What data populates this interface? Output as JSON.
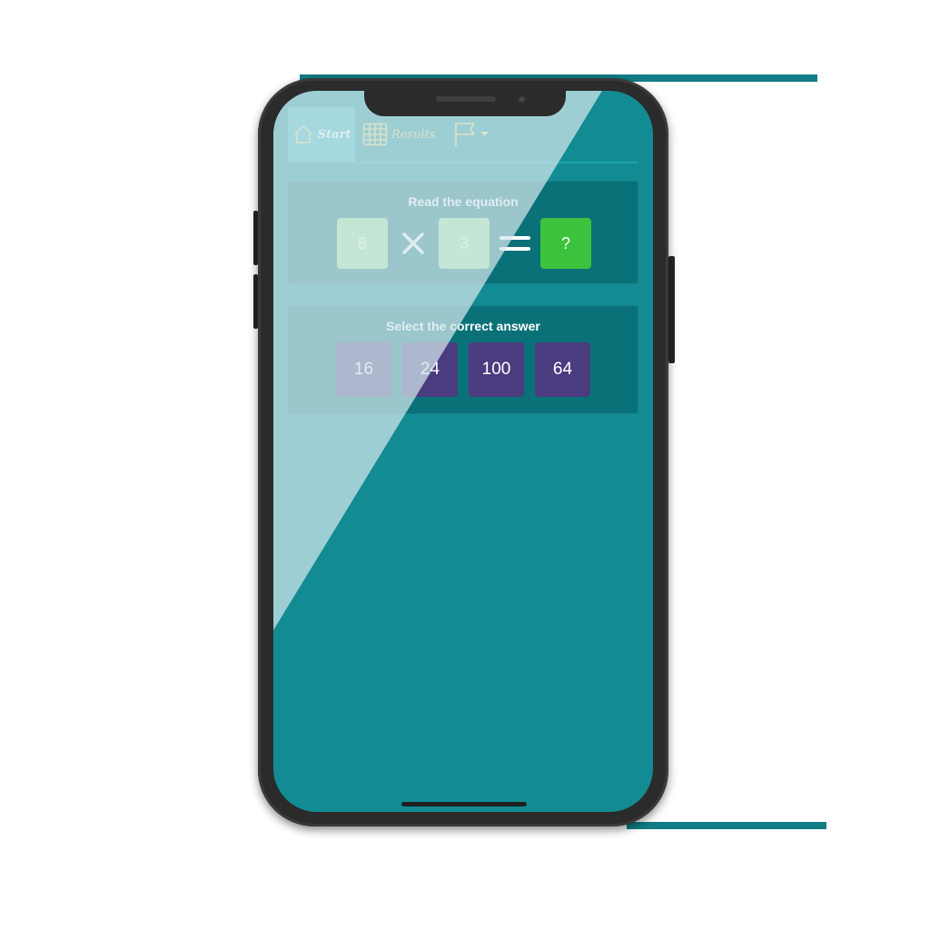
{
  "nav": {
    "start_label": "Start",
    "results_label": "Results",
    "language_icon": "flag-icon"
  },
  "equation": {
    "title": "Read the equation",
    "left_operand": "8",
    "operator_icon": "multiply-icon",
    "right_operand": "3",
    "equals_icon": "equals-icon",
    "result": "?"
  },
  "answers": {
    "title": "Select the correct answer",
    "options": [
      "16",
      "24",
      "100",
      "64"
    ]
  },
  "colors": {
    "screen_bg": "#128b93",
    "panel_bg": "#0b7179",
    "operand_tile": "#9fe09c",
    "result_tile": "#3cc23c",
    "answer_tile": "#4b3c80",
    "nav_text": "#f0d27a"
  }
}
